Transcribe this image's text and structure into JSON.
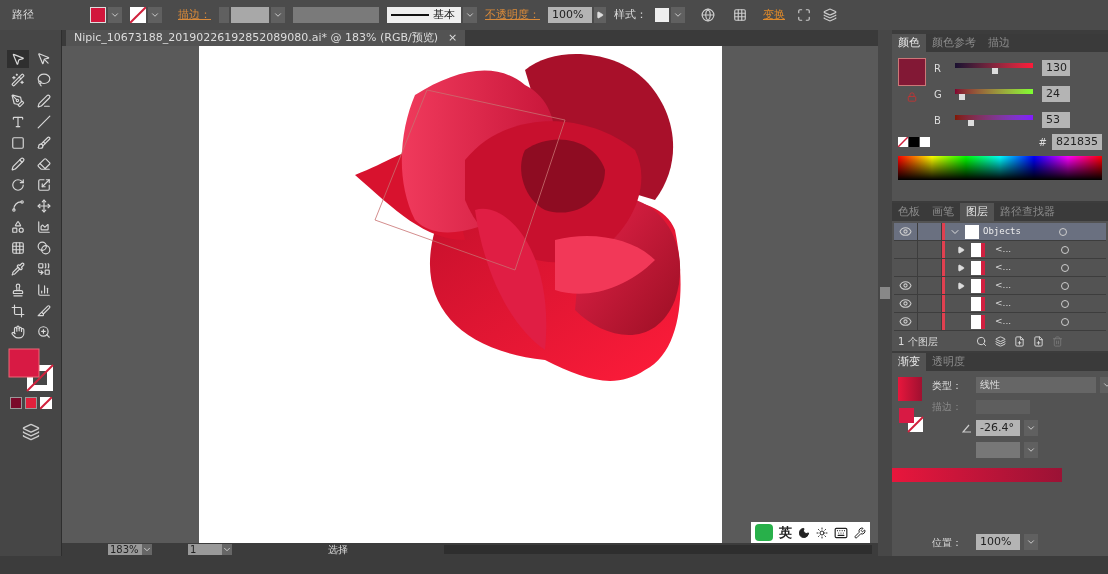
{
  "control_bar": {
    "object_type": "路径",
    "stroke_label": "描边：",
    "brush": "基本",
    "opacity_label": "不透明度：",
    "opacity": "100%",
    "style_label": "样式：",
    "transform_link": "变换"
  },
  "document_tab": {
    "title": "Nipic_10673188_20190226192852089080.ai* @ 183% (RGB/预览)",
    "close": "×"
  },
  "tools": [
    {
      "selected": true
    },
    {
      "selected": false
    },
    {
      "selected": false
    },
    {
      "selected": false
    },
    {
      "selected": false
    },
    {
      "selected": false
    },
    {
      "selected": false
    },
    {
      "selected": false
    },
    {
      "selected": false
    },
    {
      "selected": false
    },
    {
      "selected": false
    },
    {
      "selected": false
    },
    {
      "selected": false
    },
    {
      "selected": false
    },
    {
      "selected": false
    },
    {
      "selected": false
    },
    {
      "selected": false
    },
    {
      "selected": false
    },
    {
      "selected": false
    },
    {
      "selected": false
    },
    {
      "selected": false
    },
    {
      "selected": false
    },
    {
      "selected": false
    },
    {
      "selected": false
    },
    {
      "selected": false
    },
    {
      "selected": false
    },
    {
      "selected": false
    },
    {
      "selected": false
    }
  ],
  "color_panel": {
    "tabs": [
      {
        "label": "颜色",
        "selected": true
      },
      {
        "label": "颜色参考",
        "selected": false
      },
      {
        "label": "描边",
        "selected": false
      }
    ],
    "channels": [
      {
        "name": "R",
        "value": "130",
        "level": 0.51
      },
      {
        "name": "G",
        "value": "24",
        "level": 0.094
      },
      {
        "name": "B",
        "value": "53",
        "level": 0.208
      }
    ],
    "hex_label": "#",
    "hex": "821835"
  },
  "layers_panel": {
    "tabs": [
      {
        "label": "色板",
        "selected": false
      },
      {
        "label": "画笔",
        "selected": false
      },
      {
        "label": "图层",
        "selected": true
      },
      {
        "label": "路径查找器",
        "selected": false
      }
    ],
    "layers": [
      {
        "name": "Objects",
        "visible": true,
        "expanded": true,
        "selected": true,
        "children": [
          {
            "name": "<...",
            "visible": false,
            "expandable": true,
            "selected": false
          },
          {
            "name": "<...",
            "visible": false,
            "expandable": true,
            "selected": false
          },
          {
            "name": "<...",
            "visible": true,
            "expandable": true,
            "selected": false
          },
          {
            "name": "<...",
            "visible": true,
            "expandable": false,
            "selected": false
          },
          {
            "name": "<...",
            "visible": true,
            "expandable": false,
            "selected": false
          }
        ]
      }
    ],
    "footer": "1 个图层"
  },
  "gradient_panel": {
    "tabs": [
      {
        "label": "渐变",
        "selected": true
      },
      {
        "label": "透明度",
        "selected": false
      }
    ],
    "type_label": "类型：",
    "type": "线性",
    "stroke_label": "描边：",
    "angle": "-26.4°",
    "location_label": "位置：",
    "location": "100%"
  },
  "status_bar": {
    "zoom": "183%",
    "artboard": "1",
    "status": "选择"
  },
  "ime_bar": {
    "mode": "英"
  }
}
